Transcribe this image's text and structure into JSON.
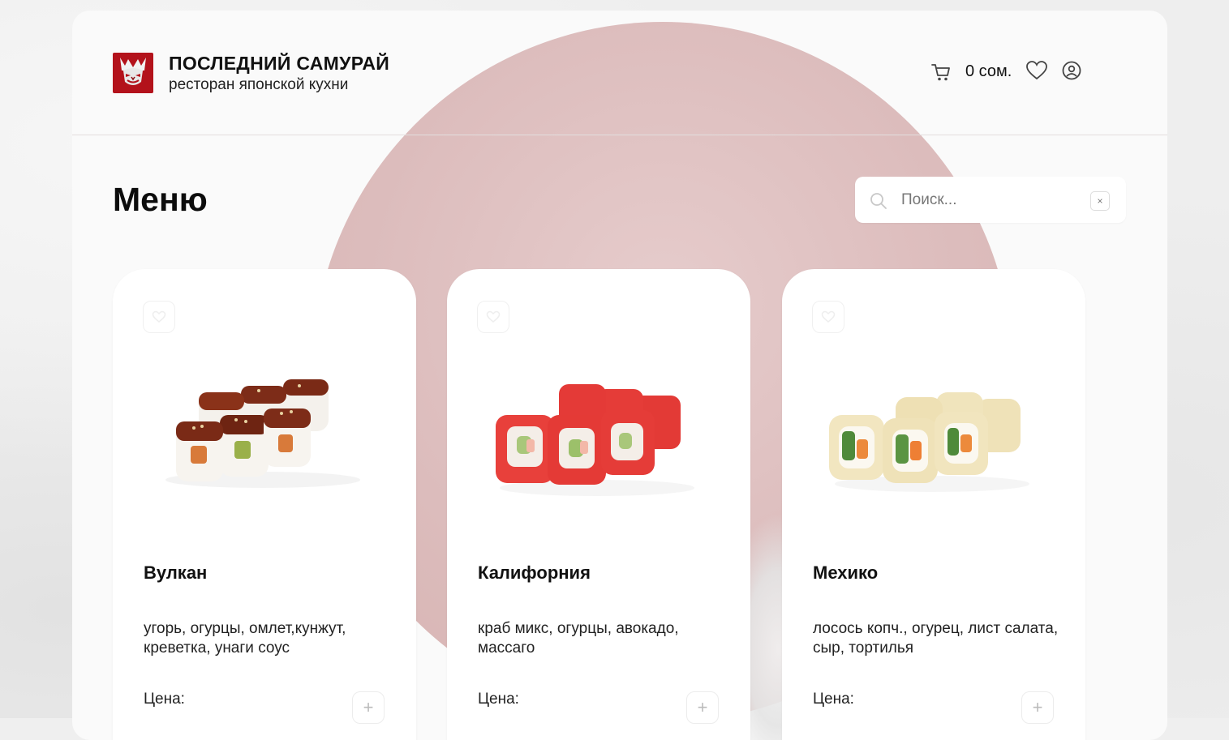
{
  "header": {
    "brand_title": "ПОСЛЕДНИЙ САМУРАЙ",
    "brand_subtitle": "ресторан японской кухни",
    "cart_total": "0 сом.",
    "icons": [
      "cart-icon",
      "heart-icon",
      "user-icon"
    ]
  },
  "page": {
    "title": "Меню"
  },
  "search": {
    "placeholder": "Поиск...",
    "value": "",
    "clear_label": "×"
  },
  "products": [
    {
      "name": "Вулкан",
      "description": "угорь, огурцы, омлет,кунжут, креветка, унаги соус",
      "price_label": "Цена:",
      "add_label": "+"
    },
    {
      "name": "Калифорния",
      "description": "краб микс, огурцы, авокадо, массаго",
      "price_label": "Цена:",
      "add_label": "+"
    },
    {
      "name": "Мехико",
      "description": "лосось копч., огурец, лист салата, сыр, тортилья",
      "price_label": "Цена:",
      "add_label": "+"
    }
  ],
  "colors": {
    "brand_red": "#b3121b",
    "sun": "#dcbcbc",
    "panel": "#fafafa",
    "card": "#ffffff"
  }
}
